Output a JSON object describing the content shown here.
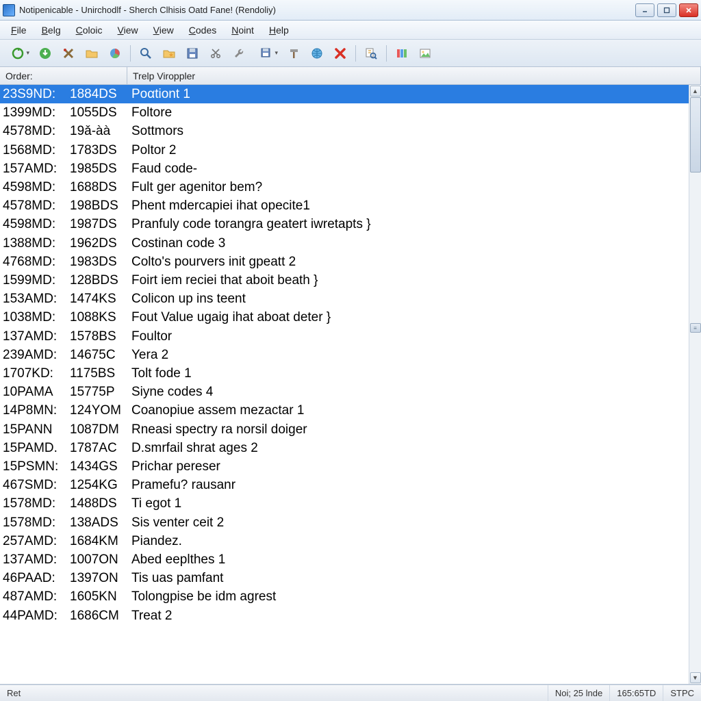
{
  "window": {
    "title": "Notipenicable - Unirchodlf - Sherch Clhisis Oatd Fane! (Rendoliy)"
  },
  "menu": {
    "items": [
      "File",
      "Belg",
      "Coloic",
      "View",
      "View",
      "Codes",
      "Noint",
      "Help"
    ]
  },
  "toolbar": {
    "icons": [
      "refresh-green-icon",
      "download-green-icon",
      "tools-x-icon",
      "folder-open-icon",
      "piechart-icon",
      "sep",
      "search-icon",
      "folder-star-icon",
      "disk-icon",
      "scissor-icon",
      "wrench-icon",
      "save-dd-icon",
      "hammer-icon",
      "globe-icon",
      "delete-x-icon",
      "sep",
      "inspect-icon",
      "sep",
      "columns-icon",
      "image-icon"
    ]
  },
  "columns": {
    "order_label": "Order:",
    "right_label": "Trelp Viroppler"
  },
  "list": {
    "selected_index": 0,
    "rows": [
      {
        "c1": "23S9ND:",
        "c2": "1884DS",
        "c3": "Poαtiont 1"
      },
      {
        "c1": "1399MD:",
        "c2": "1055DS",
        "c3": "Foltore"
      },
      {
        "c1": "4578MD:",
        "c2": "19ǎ-àà",
        "c3": "Sottmors"
      },
      {
        "c1": "1568MD:",
        "c2": "1783DS",
        "c3": "Poltor 2"
      },
      {
        "c1": "157AMD:",
        "c2": "1985DS",
        "c3": "Faud code-"
      },
      {
        "c1": "4598MD:",
        "c2": "1688DS",
        "c3": "Fult ger agenitor bem?"
      },
      {
        "c1": "4578MD:",
        "c2": "198BDS",
        "c3": "Phent mdercapiei ihat opecite1"
      },
      {
        "c1": "4598MD:",
        "c2": "1987DS",
        "c3": "Pranfuly code torangra geatert iwretapts }"
      },
      {
        "c1": "1388MD:",
        "c2": "1962DS",
        "c3": "Costinan code 3"
      },
      {
        "c1": "4768MD:",
        "c2": "1983DS",
        "c3": "Colto's pourvers init gpeatt 2"
      },
      {
        "c1": "1599MD:",
        "c2": "128BDS",
        "c3": "Foirt iem reciei that aboit beath }"
      },
      {
        "c1": "153AMD:",
        "c2": "1474KS",
        "c3": "Colicon up ins teent"
      },
      {
        "c1": "1038MD:",
        "c2": "1088KS",
        "c3": "Fout Value ugaig ihat aboat deter }"
      },
      {
        "c1": "137AMD:",
        "c2": "1578BS",
        "c3": "Foultor"
      },
      {
        "c1": "239AMD:",
        "c2": "14675C",
        "c3": "Yera 2"
      },
      {
        "c1": "1707KD:",
        "c2": "1175BS",
        "c3": "Tolt fode 1"
      },
      {
        "c1": "10PAMA",
        "c2": "15775P",
        "c3": "Siyne codes 4"
      },
      {
        "c1": "14P8MN:",
        "c2": "124YOM",
        "c3": "Coanopiue assem mezactar 1"
      },
      {
        "c1": "15PANN",
        "c2": "1087DM",
        "c3": "Rneasi spectry ra norsil doiger"
      },
      {
        "c1": "15PAMD.",
        "c2": "1787AC",
        "c3": "D.smrfail shrat ages 2"
      },
      {
        "c1": "15PSMN:",
        "c2": "1434GS",
        "c3": "Prichar pereser"
      },
      {
        "c1": "467SMD:",
        "c2": "1254KG",
        "c3": "Pramefu? rausanr"
      },
      {
        "c1": "1578MD:",
        "c2": "1488DS",
        "c3": "Ti egot 1"
      },
      {
        "c1": "1578MD:",
        "c2": "138ADS",
        "c3": "Sis venter ceit 2"
      },
      {
        "c1": "257AMD:",
        "c2": "1684KM",
        "c3": "Piandez."
      },
      {
        "c1": "137AMD:",
        "c2": "1007ON",
        "c3": "Abed eeplthes 1"
      },
      {
        "c1": "46PAAD:",
        "c2": "1397ON",
        "c3": "Tis uas pamfant"
      },
      {
        "c1": "487AMD:",
        "c2": "1605KN",
        "c3": "Tolongpise be idm agrest"
      },
      {
        "c1": "44PAMD:",
        "c2": "1686CM",
        "c3": "Treat 2"
      }
    ]
  },
  "status": {
    "left": "Ret",
    "cell1": "Noi; 25 lnde",
    "cell2": "165:65TD",
    "cell3": "STPC"
  }
}
